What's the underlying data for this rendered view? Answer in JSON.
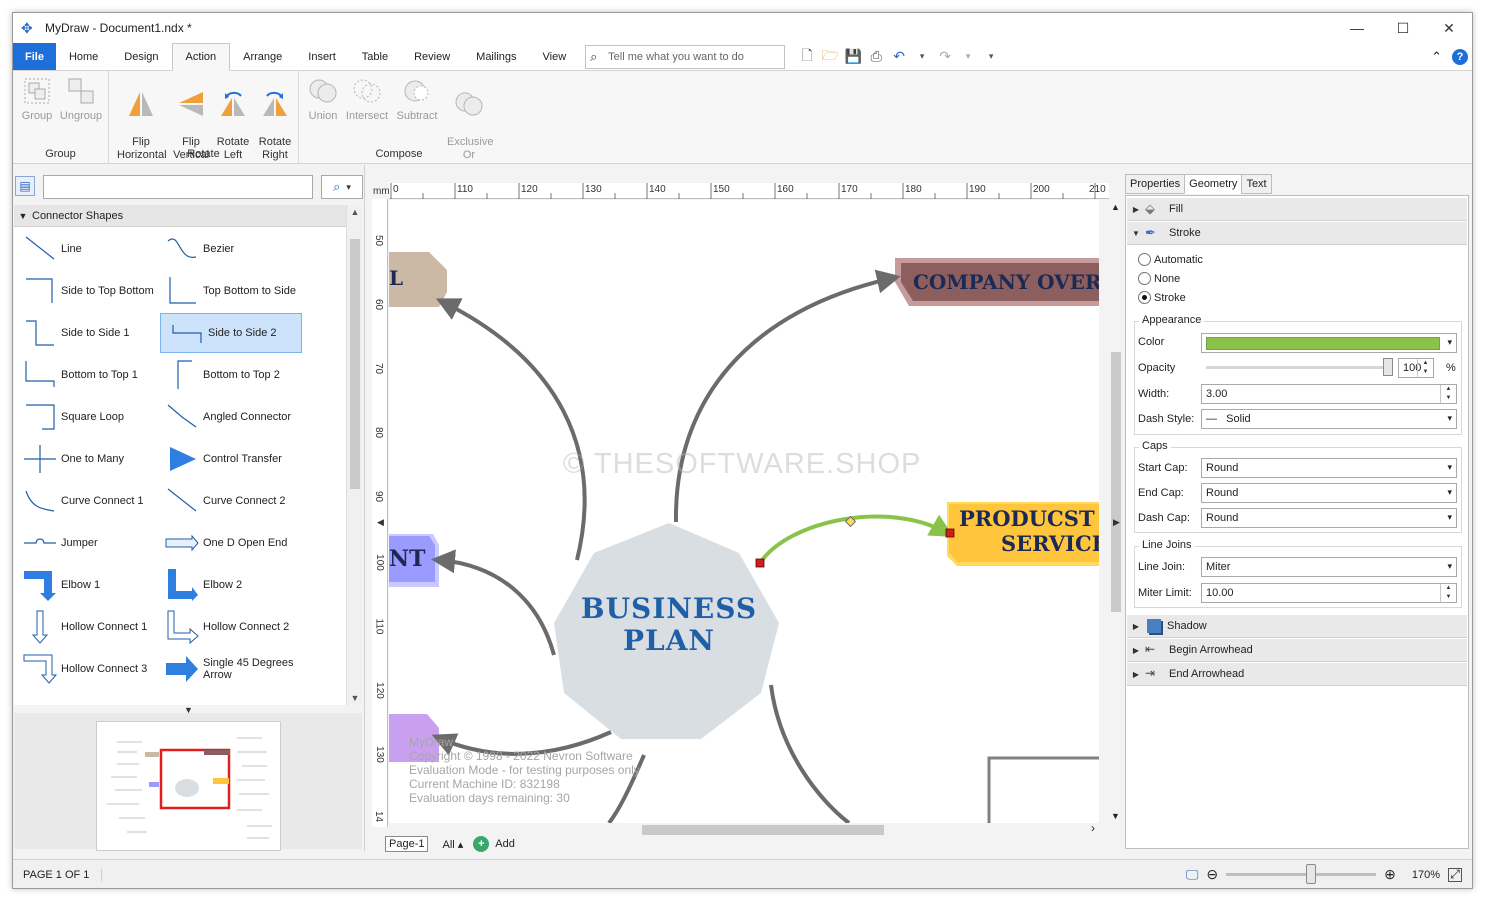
{
  "window": {
    "title": "MyDraw - Document1.ndx *",
    "controls": {
      "minimize": "—",
      "maximize": "☐",
      "close": "✕"
    }
  },
  "ribbon": {
    "tabs": [
      "File",
      "Home",
      "Design",
      "Action",
      "Arrange",
      "Insert",
      "Table",
      "Review",
      "Mailings",
      "View"
    ],
    "active_tab": "Action",
    "tell_me_placeholder": "Tell me what you want to do",
    "groups": {
      "group": {
        "label": "Group",
        "buttons": [
          "Group",
          "Ungroup"
        ]
      },
      "rotate": {
        "label": "Rotate",
        "buttons": [
          "Flip\nHorizontal",
          "Flip\nVertical",
          "Rotate\nLeft",
          "Rotate\nRight"
        ]
      },
      "compose": {
        "label": "Compose",
        "buttons": [
          "Union",
          "Intersect",
          "Subtract",
          "Exclusive\nOr"
        ]
      }
    }
  },
  "left_panel": {
    "search_value": "",
    "section_title": "Connector Shapes",
    "shapes": [
      [
        "Line",
        "Bezier"
      ],
      [
        "Side to Top Bottom",
        "Top Bottom to Side"
      ],
      [
        "Side to Side 1",
        "Side to Side 2"
      ],
      [
        "Bottom to Top 1",
        "Bottom to Top 2"
      ],
      [
        "Square Loop",
        "Angled Connector"
      ],
      [
        "One to Many",
        "Control Transfer"
      ],
      [
        "Curve Connect 1",
        "Curve Connect 2"
      ],
      [
        "Jumper",
        "One D Open End"
      ],
      [
        "Elbow 1",
        "Elbow 2"
      ],
      [
        "Hollow Connect 1",
        "Hollow Connect 2"
      ],
      [
        "Hollow Connect 3",
        "Single 45 Degrees Arrow"
      ]
    ],
    "selected_shape": "Side to Side 2"
  },
  "ruler": {
    "unit": "mm",
    "top_ticks": [
      "0",
      "110",
      "120",
      "130",
      "140",
      "150",
      "160",
      "170",
      "180",
      "190",
      "200",
      "210"
    ],
    "left_ticks": [
      "50",
      "60",
      "70",
      "80",
      "90",
      "100",
      "110",
      "120",
      "130",
      "14"
    ]
  },
  "canvas": {
    "center_title_line1": "BUSINESS",
    "center_title_line2": "PLAN",
    "node_company": "COMPANY OVERVI",
    "node_products_line1": "PRODUCST A",
    "node_products_line2": "SERVICES",
    "node_left_top": "L",
    "node_left_mid": "NT",
    "watermark": "© THESOFTWARE.SHOP",
    "eval_lines": [
      "MyDraw",
      "Copyright © 1998 - 2022 Nevron Software",
      "Evaluation Mode - for testing purposes only",
      "Current Machine ID: 832198",
      "Evaluation days remaining: 30"
    ],
    "colors": {
      "connector": "#6b6b6b",
      "selected_connector": "#8bc34a",
      "center_node": "#d9dee3",
      "title_text": "#1f5fa8"
    }
  },
  "page_bar": {
    "page": "Page-1",
    "all": "All ▴",
    "add": "Add"
  },
  "right_panel": {
    "tabs": [
      "Properties",
      "Geometry",
      "Text"
    ],
    "active_tab": "Geometry",
    "sections": {
      "fill": "Fill",
      "stroke": "Stroke",
      "shadow": "Shadow",
      "begin_arrowhead": "Begin Arrowhead",
      "end_arrowhead": "End Arrowhead"
    },
    "stroke_options": [
      "Automatic",
      "None",
      "Stroke"
    ],
    "stroke_selected": "Stroke",
    "appearance": {
      "legend": "Appearance",
      "color_label": "Color",
      "color_value": "#8bc34a",
      "opacity_label": "Opacity",
      "opacity_value": "100",
      "opacity_unit": "%",
      "width_label": "Width:",
      "width_value": "3.00",
      "dash_label": "Dash Style:",
      "dash_value": "—   Solid"
    },
    "caps": {
      "legend": "Caps",
      "start_label": "Start Cap:",
      "start_value": "Round",
      "end_label": "End Cap:",
      "end_value": "Round",
      "dash_label": "Dash Cap:",
      "dash_value": "Round"
    },
    "joins": {
      "legend": "Line Joins",
      "join_label": "Line Join:",
      "join_value": "Miter",
      "limit_label": "Miter Limit:",
      "limit_value": "10.00"
    }
  },
  "status_bar": {
    "page_info": "PAGE 1 OF 1",
    "zoom": "170%",
    "zoom_level_fraction": 0.57
  }
}
